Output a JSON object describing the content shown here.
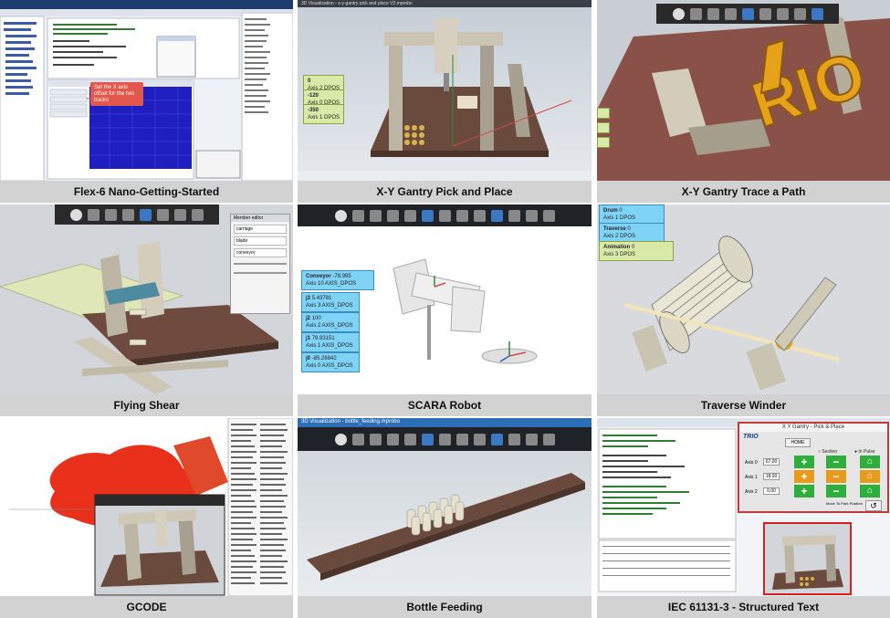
{
  "tiles": [
    {
      "id": "flex6",
      "caption": "Flex-6 Nano-Getting-Started"
    },
    {
      "id": "xy-pick",
      "caption": "X-Y Gantry Pick and Place"
    },
    {
      "id": "xy-trace",
      "caption": "X-Y Gantry Trace a Path"
    },
    {
      "id": "shear",
      "caption": "Flying Shear"
    },
    {
      "id": "scara",
      "caption": "SCARA Robot"
    },
    {
      "id": "winder",
      "caption": "Traverse Winder"
    },
    {
      "id": "gcode",
      "caption": "GCODE"
    },
    {
      "id": "bottle",
      "caption": "Bottle Feeding"
    },
    {
      "id": "iec",
      "caption": "IEC 61131-3 - Structured Text"
    }
  ],
  "flex6": {
    "tooltip": "Set the X axis offset for the two tracks"
  },
  "xypick": {
    "title": "3D Visualization - x-y-gantry pick and place V2.mprobo",
    "labels": [
      {
        "value": "0",
        "name": "Axis 2 DPOS"
      },
      {
        "value": "-120",
        "name": "Axis 0 DPOS"
      },
      {
        "value": "-350",
        "name": "Axis 1 DPOS"
      }
    ]
  },
  "shear": {
    "panel_title": "Member editor",
    "items": [
      "carriage",
      "blade",
      "conveyor"
    ]
  },
  "scara": {
    "labels": [
      {
        "key": "Conveyor",
        "value": "-78.995",
        "name": "Axis 10  AXIS_DPOS"
      },
      {
        "key": "j3",
        "value": "5.43781",
        "name": "Axis 3  AXIS_DPOS"
      },
      {
        "key": "j2",
        "value": "100",
        "name": "Axis 2  AXIS_DPOS"
      },
      {
        "key": "j1",
        "value": "79.93151",
        "name": "Axis 1  AXIS_DPOS"
      },
      {
        "key": "j0",
        "value": "-85.26842",
        "name": "Axis 0  AXIS_DPOS"
      }
    ]
  },
  "winder": {
    "labels": [
      {
        "key": "Drum",
        "value": "0",
        "name": "Axis 1 DPOS"
      },
      {
        "key": "Traverse",
        "value": "0",
        "name": "Axis 2 DPOS"
      },
      {
        "key": "Animation",
        "value": "0",
        "name": "Axis 3 DPOS"
      }
    ]
  },
  "bottle": {
    "title": "3D Visualization - bottle_feeding.mprobo"
  },
  "iec": {
    "hmi_title": "X Y Gantry - Pick & Place",
    "brand": "TRIO",
    "button_top": "HOME",
    "axis_rows": [
      {
        "label": "Axis 0",
        "value": "67.00"
      },
      {
        "label": "Axis 1",
        "value": "18.00"
      },
      {
        "label": "Axis 2",
        "value": "0.00"
      }
    ],
    "radio": [
      "Section",
      "In Pulse"
    ],
    "move_label": "Move To Park Position"
  }
}
